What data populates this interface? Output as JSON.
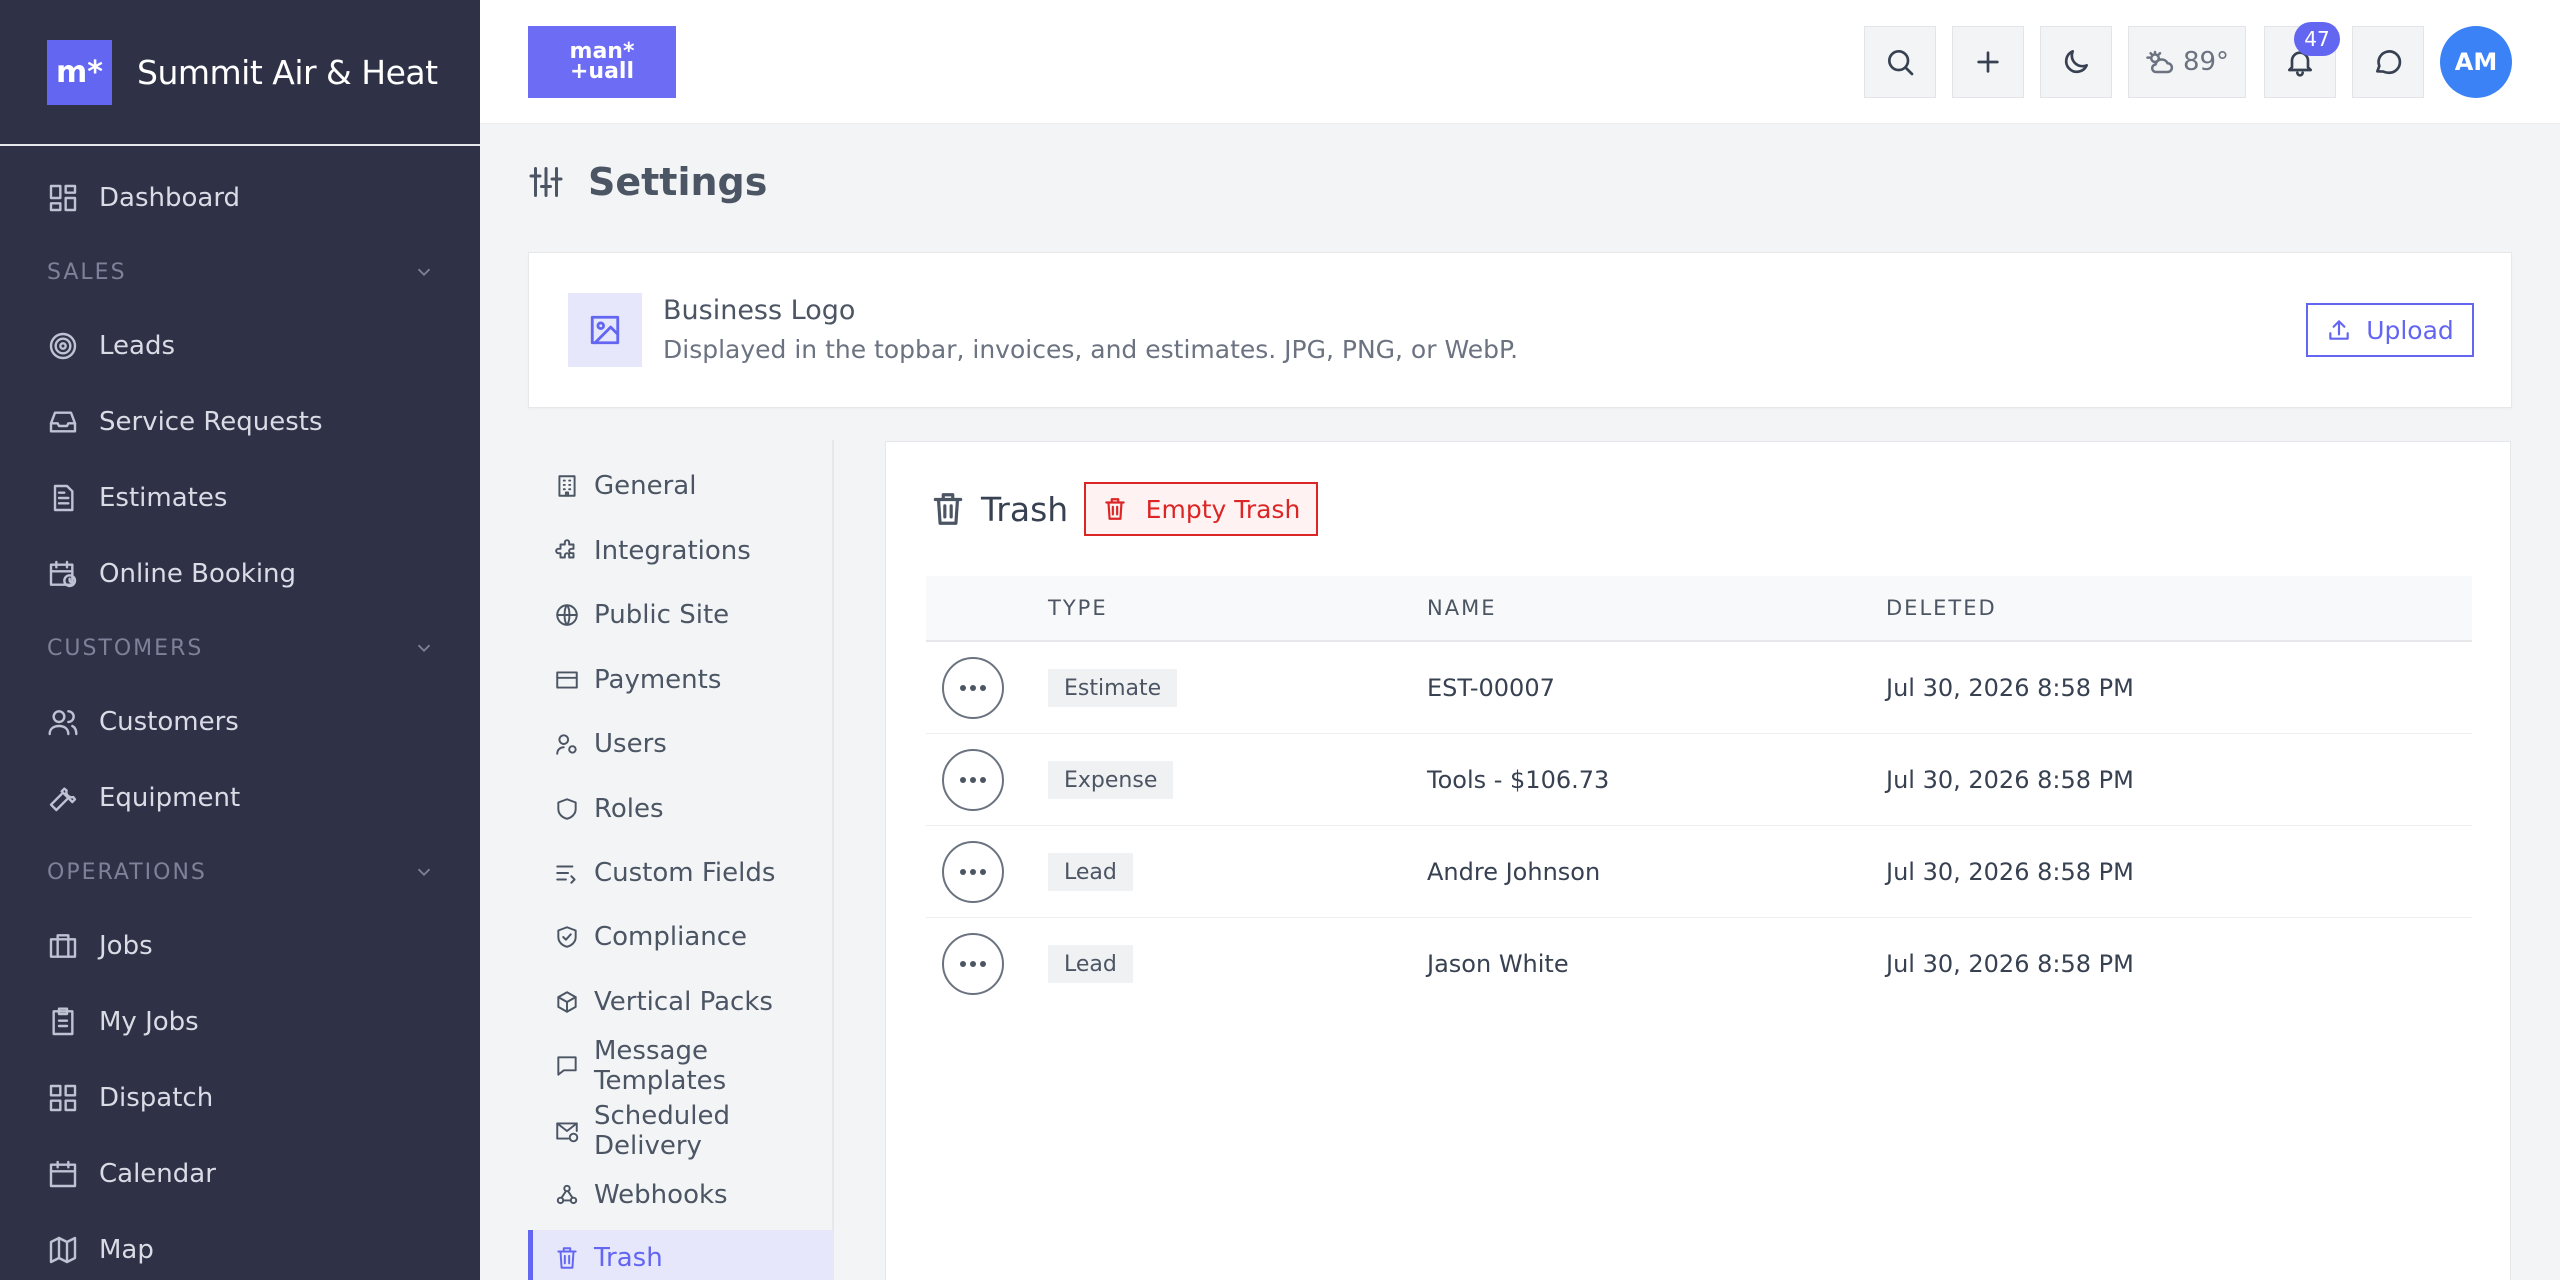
{
  "sidebar": {
    "brand_mark": "m*",
    "brand_name": "Summit Air & Heat",
    "items": {
      "dashboard": "Dashboard",
      "sales": "SALES",
      "leads": "Leads",
      "service_requests": "Service Requests",
      "estimates": "Estimates",
      "online_booking": "Online Booking",
      "customers_section": "CUSTOMERS",
      "customers": "Customers",
      "equipment": "Equipment",
      "operations": "OPERATIONS",
      "jobs": "Jobs",
      "my_jobs": "My Jobs",
      "dispatch": "Dispatch",
      "calendar": "Calendar",
      "map": "Map"
    }
  },
  "topbar": {
    "logo_line1": "man*",
    "logo_line2": "+uall",
    "weather": "89°",
    "notification_count": "47",
    "avatar_initials": "AM"
  },
  "page": {
    "title": "Settings"
  },
  "logo_card": {
    "title": "Business Logo",
    "description": "Displayed in the topbar, invoices, and estimates. JPG, PNG, or WebP.",
    "upload_label": "Upload"
  },
  "settings_nav": {
    "general": "General",
    "integrations": "Integrations",
    "public_site": "Public Site",
    "payments": "Payments",
    "users": "Users",
    "roles": "Roles",
    "custom_fields": "Custom Fields",
    "compliance": "Compliance",
    "vertical_packs": "Vertical Packs",
    "message_templates": "Message Templates",
    "scheduled_delivery": "Scheduled Delivery",
    "webhooks": "Webhooks",
    "trash": "Trash"
  },
  "trash": {
    "title": "Trash",
    "empty_label": "Empty Trash",
    "columns": {
      "type": "TYPE",
      "name": "NAME",
      "deleted": "DELETED"
    },
    "rows": [
      {
        "type": "Estimate",
        "name": "EST-00007",
        "deleted": "Jul 30, 2026 8:58 PM"
      },
      {
        "type": "Expense",
        "name": "Tools - $106.73",
        "deleted": "Jul 30, 2026 8:58 PM"
      },
      {
        "type": "Lead",
        "name": "Andre Johnson",
        "deleted": "Jul 30, 2026 8:58 PM"
      },
      {
        "type": "Lead",
        "name": "Jason White",
        "deleted": "Jul 30, 2026 8:58 PM"
      }
    ]
  },
  "colors": {
    "sidebar_bg": "#2f3247",
    "accent": "#6366f1",
    "danger": "#dc2626",
    "avatar": "#3b82f6"
  }
}
